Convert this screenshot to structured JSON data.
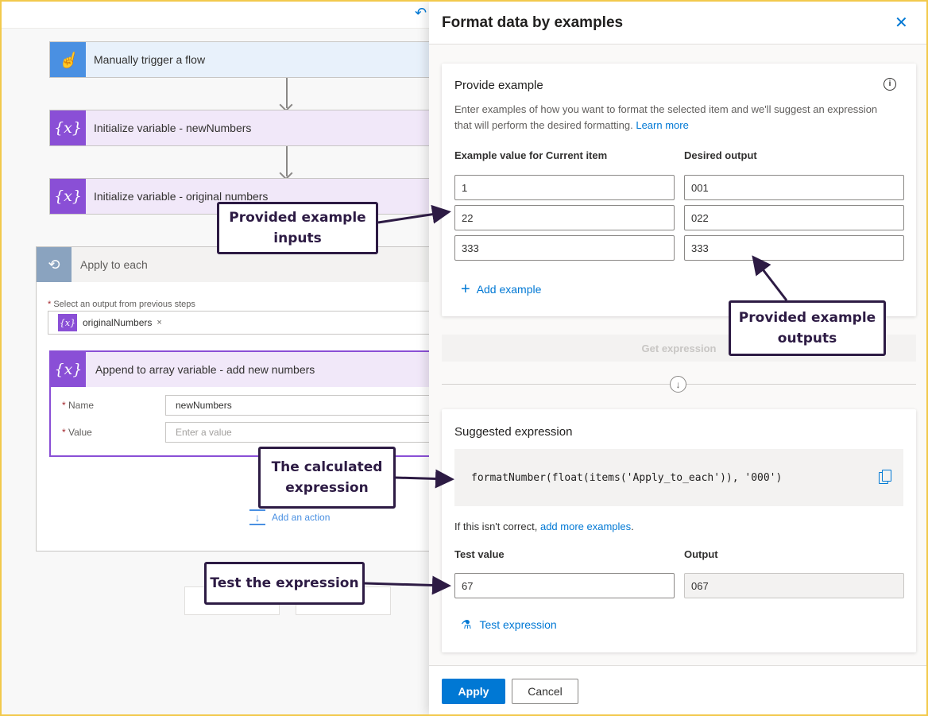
{
  "canvas": {
    "steps": {
      "trigger": "Manually trigger a flow",
      "init_new": "Initialize variable - newNumbers",
      "init_original": "Initialize variable - original numbers"
    },
    "apply_to_each": {
      "title": "Apply to each",
      "select_label": "Select an output from previous steps",
      "token": "originalNumbers",
      "token_remove": "×"
    },
    "append": {
      "title": "Append to array variable - add new numbers",
      "name_label": "Name",
      "name_value": "newNumbers",
      "value_label": "Value",
      "value_placeholder": "Enter a value"
    },
    "add_action": "Add an action"
  },
  "panel": {
    "title": "Format data by examples",
    "close_icon": "close-icon",
    "provide_example": {
      "title": "Provide example",
      "description": "Enter examples of how you want to format the selected item and we'll suggest an expression that will perform the desired formatting.",
      "learn_more": "Learn more",
      "input_header": "Example value for Current item",
      "output_header": "Desired output",
      "rows": [
        {
          "input": "1",
          "output": "001"
        },
        {
          "input": "22",
          "output": "022"
        },
        {
          "input": "333",
          "output": "333"
        }
      ],
      "add_example": "Add example"
    },
    "get_expression": "Get expression",
    "suggested": {
      "title": "Suggested expression",
      "expression": "formatNumber(float(items('Apply_to_each')), '000')",
      "hint_prefix": "If this isn't correct, ",
      "hint_link": "add more examples",
      "hint_suffix": ".",
      "test_value_label": "Test value",
      "output_label": "Output",
      "test_value": "67",
      "output_value": "067",
      "test_button": "Test expression"
    },
    "footer": {
      "apply": "Apply",
      "cancel": "Cancel"
    }
  },
  "callouts": {
    "inputs": "Provided example inputs",
    "outputs": "Provided example outputs",
    "expression": "The calculated expression",
    "test": "Test the expression"
  },
  "colors": {
    "accent": "#0078d4",
    "callout_border": "#2d1b44",
    "variable": "#8a4fd6",
    "trigger": "#4a90e2",
    "frame": "#f2c94c"
  }
}
